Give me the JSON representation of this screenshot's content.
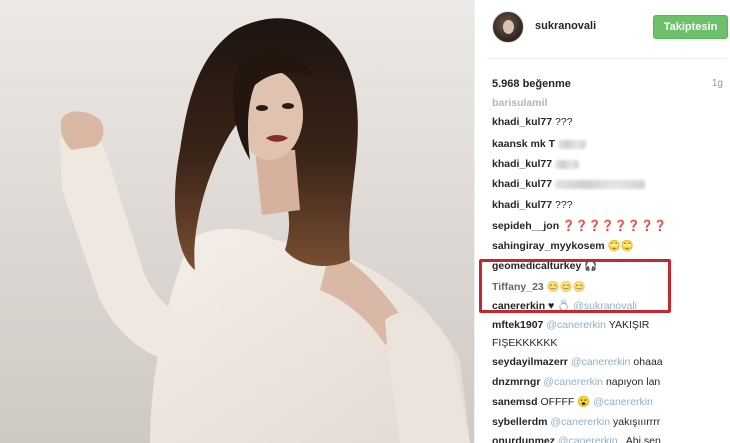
{
  "post": {
    "username": "sukranovali",
    "follow_label": "Takiptesin",
    "likes": "5.968 beğenme",
    "age": "1g"
  },
  "comments": [
    {
      "user": "barisulamil",
      "text": ""
    },
    {
      "user": "khadi_kul77",
      "text": "???"
    },
    {
      "user": "kaansk mk T",
      "text": ""
    },
    {
      "user": "khadi_kul77",
      "text": ""
    },
    {
      "user": "khadi_kul77",
      "text": ""
    },
    {
      "user": "khadi_kul77",
      "text": "???"
    },
    {
      "user": "sepideh__jon",
      "text": "❓❓❓❓❓❓❓❓"
    },
    {
      "user": "sahingiray_myykosem",
      "text": "🙄🙄"
    },
    {
      "user": "geomedicalturkey",
      "text": "🎧"
    },
    {
      "user": "Tiffany_23",
      "text": "😊😊😊"
    },
    {
      "user": "canererkin",
      "text": "♥ 💍",
      "mention": "@sukranovali"
    },
    {
      "user": "mftek1907",
      "text": "",
      "mention": "@canererkin",
      "tail": "YAKIŞIR"
    },
    {
      "user": "",
      "text": "FIŞEKKKKKK"
    },
    {
      "user": "seydayilmazerr",
      "text": "",
      "mention": "@canererkin",
      "tail": "ohaaa"
    },
    {
      "user": "dnzmrngr",
      "text": "",
      "mention": "@canererkin",
      "tail": "napıyon lan"
    },
    {
      "user": "sanemsd",
      "text": "OFFFF 😮",
      "mention": "@canererkin"
    },
    {
      "user": "sybellerdm",
      "text": "",
      "mention": "@canererkin",
      "tail": "yakışııırrrr"
    },
    {
      "user": "onurdunmez",
      "text": "",
      "mention": "@canererkin",
      "tail": ". Abi sen"
    }
  ],
  "icons": {
    "avatar": "profile-avatar",
    "highlight": "red-highlight-frame"
  },
  "colors": {
    "follow_button": "#6cc069",
    "mention": "#8fb0c9",
    "highlight": "#c8252c"
  }
}
